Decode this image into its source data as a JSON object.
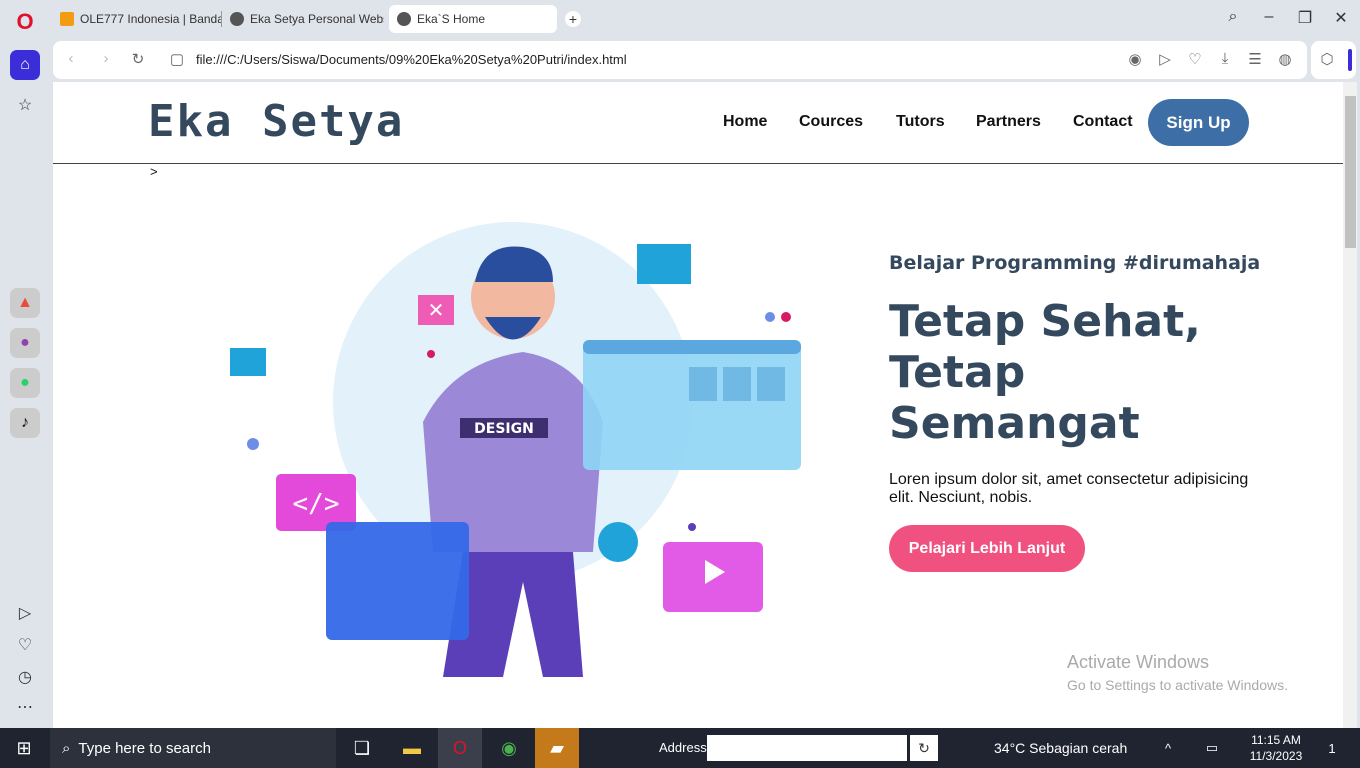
{
  "browser": {
    "tabs": [
      {
        "label": "OLE777 Indonesia | Banda",
        "icon": "ole777-favicon"
      },
      {
        "label": "Eka Setya Personal Websi",
        "icon": "globe-icon"
      },
      {
        "label": "Eka`S Home",
        "icon": "globe-icon"
      }
    ],
    "url": "file:///C:/Users/Siswa/Documents/09%20Eka%20Setya%20Putri/index.html"
  },
  "site": {
    "brand": "Eka Setya",
    "menu": [
      "Home",
      "Cources",
      "Tutors",
      "Partners",
      "Contact"
    ],
    "signup": "Sign Up",
    "stray": ">",
    "kicker": "Belajar Programming #dirumahaja",
    "headline_line1": "Tetap Sehat,",
    "headline_line2": "Tetap Semangat",
    "lead": "Loren ipsum dolor sit, amet consectetur adipisicing elit. Nesciunt, nobis.",
    "cta": "Pelajari Lebih Lanjut",
    "illustration_label": "DESIGN"
  },
  "watermark": {
    "title": "Activate Windows",
    "subtitle": "Go to Settings to activate Windows."
  },
  "taskbar": {
    "search_placeholder": "Type here to search",
    "address_label": "Address",
    "weather": "34°C  Sebagian cerah",
    "time": "11:15 AM",
    "date": "11/3/2023",
    "notif_count": "1"
  },
  "colors": {
    "heading": "#34495e",
    "signup": "#3e6ea6",
    "cta": "#f0517e"
  }
}
